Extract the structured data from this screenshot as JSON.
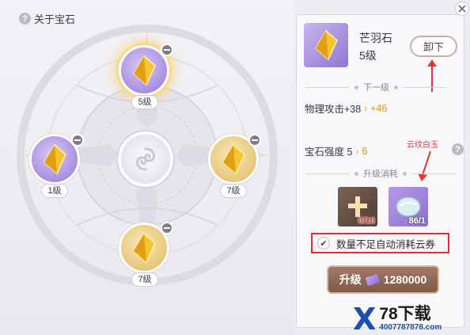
{
  "left_panel": {
    "title": "关于宝石",
    "help_glyph": "?",
    "slots": [
      {
        "level": "5级",
        "color": "purple",
        "selected": true
      },
      {
        "level": "1级",
        "color": "purple",
        "selected": false
      },
      {
        "level": "7级",
        "color": "gold",
        "selected": false
      },
      {
        "level": "7级",
        "color": "gold",
        "selected": false
      }
    ]
  },
  "detail": {
    "gem_name": "芒羽石",
    "gem_level": "5级",
    "unequip_label": "卸下",
    "next_level_label": "下一级",
    "attack_stat": "物理攻击+38",
    "attack_new": "+46",
    "strength_label": "宝石强度 5",
    "strength_new": "6",
    "upgrade_cost_label": "升级消耗",
    "material_annotation": "云纹白玉",
    "materials": [
      {
        "icon": "cross-material-icon",
        "count": "0/16"
      },
      {
        "icon": "jade-stone-icon",
        "count": "86/1"
      }
    ],
    "auto_consume_label": "数量不足自动消耗云券",
    "auto_consume_checked": "✔",
    "upgrade_label": "升级",
    "upgrade_cost": "1280000"
  },
  "watermark": {
    "logo": "X",
    "title": "78下载",
    "url": "4007787878.com"
  },
  "colors": {
    "annotation_red": "#e43838",
    "stat_increase": "#d8941f",
    "upgrade_button": "#8f6654",
    "purple_gem_slot": "#a98fe0",
    "gold_gem_slot": "#e7c77c"
  }
}
